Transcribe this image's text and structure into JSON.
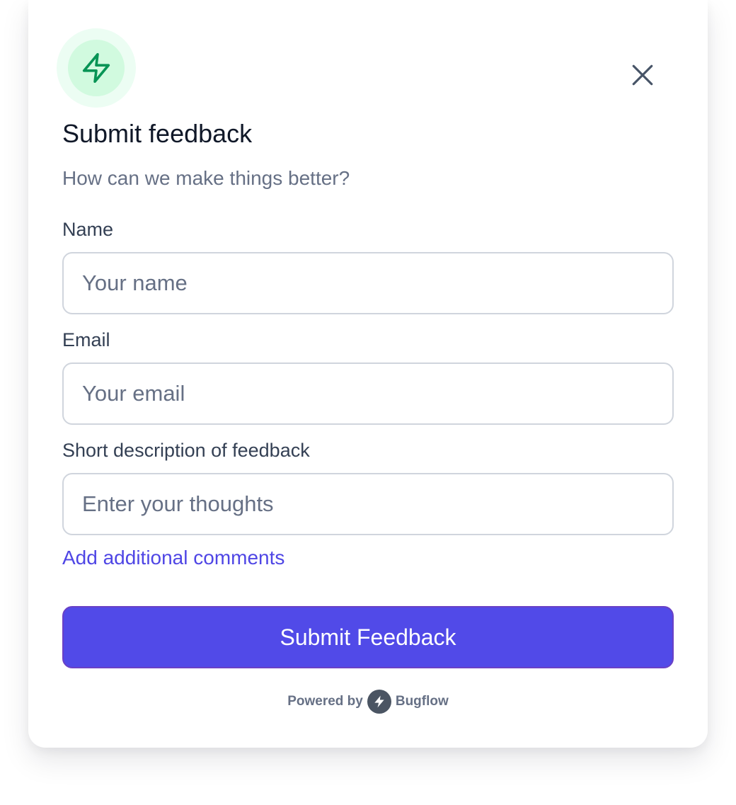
{
  "header": {
    "icon": "zap-icon",
    "title": "Submit feedback",
    "subtitle": "How can we make things better?",
    "close_icon": "close-icon"
  },
  "form": {
    "name": {
      "label": "Name",
      "placeholder": "Your name",
      "value": ""
    },
    "email": {
      "label": "Email",
      "placeholder": "Your email",
      "value": ""
    },
    "description": {
      "label": "Short description of feedback",
      "placeholder": "Enter your thoughts",
      "value": ""
    },
    "additional_link": "Add additional comments",
    "submit_label": "Submit Feedback"
  },
  "footer": {
    "powered_by": "Powered by",
    "brand": "Bugflow",
    "brand_icon": "bugflow-logo-icon"
  },
  "colors": {
    "accent": "#514ae8",
    "link": "#4f46e5",
    "success_icon": "#079455",
    "success_bg": "#d1fadf",
    "success_halo": "#ecfdf3"
  }
}
